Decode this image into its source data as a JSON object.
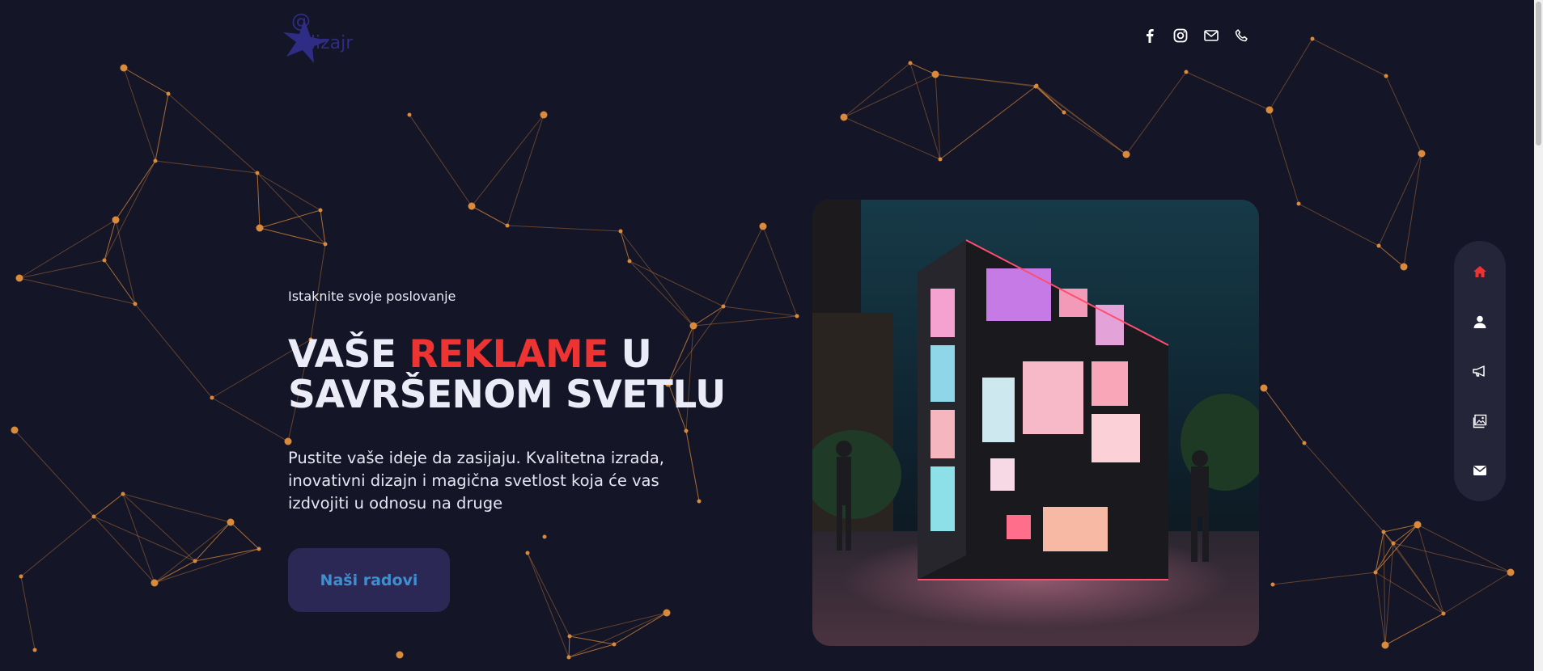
{
  "brand": {
    "logo_icon": "diamond-logo-icon",
    "logo_text": "dizajn",
    "logo_at": "@",
    "logo_color": "#2f2c86"
  },
  "socials": [
    {
      "icon": "facebook-icon"
    },
    {
      "icon": "instagram-icon"
    },
    {
      "icon": "mail-icon"
    },
    {
      "icon": "phone-icon"
    }
  ],
  "hero": {
    "eyebrow": "Istaknite svoje poslovanje",
    "title_part1": "VAŠE ",
    "title_accent": "REKLAME",
    "title_part2": " U SAVRŠENOM SVETLU",
    "lead": "Pustite vaše ideje da zasijaju. Kvalitetna izrada, inovativni dizajn i magična svetlost koja će vas izdvojiti u odnosu na druge",
    "cta_label": "Naši radovi"
  },
  "side_nav": [
    {
      "icon": "home-icon",
      "active": true
    },
    {
      "icon": "user-icon",
      "active": false
    },
    {
      "icon": "megaphone-icon",
      "active": false
    },
    {
      "icon": "gallery-icon",
      "active": false
    },
    {
      "icon": "envelope-icon",
      "active": false
    }
  ],
  "colors": {
    "background": "#141527",
    "accent_red": "#ee3333",
    "network_orange": "#d98a3a",
    "button_bg": "#2c2856",
    "button_text": "#3e8fd0",
    "side_nav_bg": "#252539"
  }
}
